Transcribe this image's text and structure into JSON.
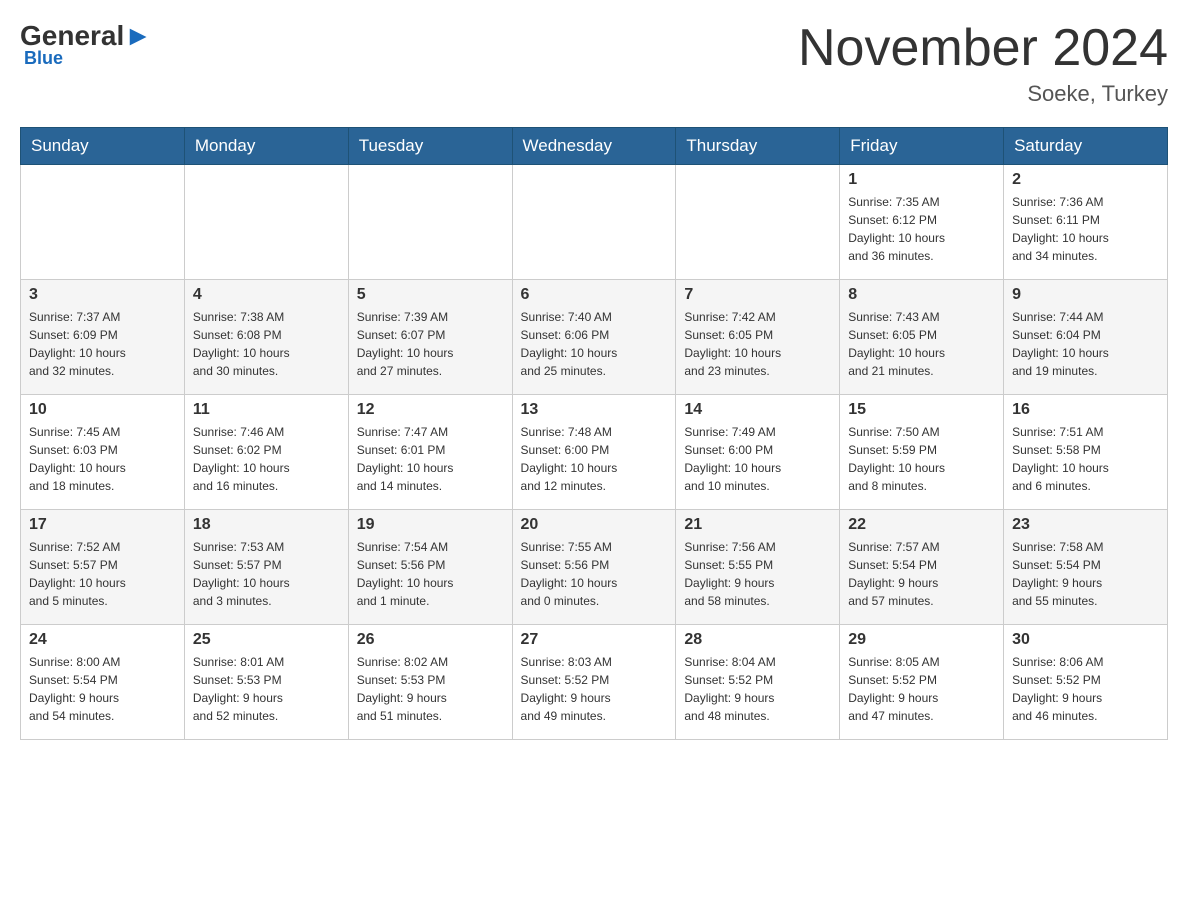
{
  "header": {
    "logo": {
      "general": "General",
      "blue": "Blue",
      "subtitle": "Blue"
    },
    "title": "November 2024",
    "location": "Soeke, Turkey"
  },
  "weekdays": [
    "Sunday",
    "Monday",
    "Tuesday",
    "Wednesday",
    "Thursday",
    "Friday",
    "Saturday"
  ],
  "weeks": [
    {
      "days": [
        {
          "number": "",
          "info": ""
        },
        {
          "number": "",
          "info": ""
        },
        {
          "number": "",
          "info": ""
        },
        {
          "number": "",
          "info": ""
        },
        {
          "number": "",
          "info": ""
        },
        {
          "number": "1",
          "info": "Sunrise: 7:35 AM\nSunset: 6:12 PM\nDaylight: 10 hours\nand 36 minutes."
        },
        {
          "number": "2",
          "info": "Sunrise: 7:36 AM\nSunset: 6:11 PM\nDaylight: 10 hours\nand 34 minutes."
        }
      ]
    },
    {
      "days": [
        {
          "number": "3",
          "info": "Sunrise: 7:37 AM\nSunset: 6:09 PM\nDaylight: 10 hours\nand 32 minutes."
        },
        {
          "number": "4",
          "info": "Sunrise: 7:38 AM\nSunset: 6:08 PM\nDaylight: 10 hours\nand 30 minutes."
        },
        {
          "number": "5",
          "info": "Sunrise: 7:39 AM\nSunset: 6:07 PM\nDaylight: 10 hours\nand 27 minutes."
        },
        {
          "number": "6",
          "info": "Sunrise: 7:40 AM\nSunset: 6:06 PM\nDaylight: 10 hours\nand 25 minutes."
        },
        {
          "number": "7",
          "info": "Sunrise: 7:42 AM\nSunset: 6:05 PM\nDaylight: 10 hours\nand 23 minutes."
        },
        {
          "number": "8",
          "info": "Sunrise: 7:43 AM\nSunset: 6:05 PM\nDaylight: 10 hours\nand 21 minutes."
        },
        {
          "number": "9",
          "info": "Sunrise: 7:44 AM\nSunset: 6:04 PM\nDaylight: 10 hours\nand 19 minutes."
        }
      ]
    },
    {
      "days": [
        {
          "number": "10",
          "info": "Sunrise: 7:45 AM\nSunset: 6:03 PM\nDaylight: 10 hours\nand 18 minutes."
        },
        {
          "number": "11",
          "info": "Sunrise: 7:46 AM\nSunset: 6:02 PM\nDaylight: 10 hours\nand 16 minutes."
        },
        {
          "number": "12",
          "info": "Sunrise: 7:47 AM\nSunset: 6:01 PM\nDaylight: 10 hours\nand 14 minutes."
        },
        {
          "number": "13",
          "info": "Sunrise: 7:48 AM\nSunset: 6:00 PM\nDaylight: 10 hours\nand 12 minutes."
        },
        {
          "number": "14",
          "info": "Sunrise: 7:49 AM\nSunset: 6:00 PM\nDaylight: 10 hours\nand 10 minutes."
        },
        {
          "number": "15",
          "info": "Sunrise: 7:50 AM\nSunset: 5:59 PM\nDaylight: 10 hours\nand 8 minutes."
        },
        {
          "number": "16",
          "info": "Sunrise: 7:51 AM\nSunset: 5:58 PM\nDaylight: 10 hours\nand 6 minutes."
        }
      ]
    },
    {
      "days": [
        {
          "number": "17",
          "info": "Sunrise: 7:52 AM\nSunset: 5:57 PM\nDaylight: 10 hours\nand 5 minutes."
        },
        {
          "number": "18",
          "info": "Sunrise: 7:53 AM\nSunset: 5:57 PM\nDaylight: 10 hours\nand 3 minutes."
        },
        {
          "number": "19",
          "info": "Sunrise: 7:54 AM\nSunset: 5:56 PM\nDaylight: 10 hours\nand 1 minute."
        },
        {
          "number": "20",
          "info": "Sunrise: 7:55 AM\nSunset: 5:56 PM\nDaylight: 10 hours\nand 0 minutes."
        },
        {
          "number": "21",
          "info": "Sunrise: 7:56 AM\nSunset: 5:55 PM\nDaylight: 9 hours\nand 58 minutes."
        },
        {
          "number": "22",
          "info": "Sunrise: 7:57 AM\nSunset: 5:54 PM\nDaylight: 9 hours\nand 57 minutes."
        },
        {
          "number": "23",
          "info": "Sunrise: 7:58 AM\nSunset: 5:54 PM\nDaylight: 9 hours\nand 55 minutes."
        }
      ]
    },
    {
      "days": [
        {
          "number": "24",
          "info": "Sunrise: 8:00 AM\nSunset: 5:54 PM\nDaylight: 9 hours\nand 54 minutes."
        },
        {
          "number": "25",
          "info": "Sunrise: 8:01 AM\nSunset: 5:53 PM\nDaylight: 9 hours\nand 52 minutes."
        },
        {
          "number": "26",
          "info": "Sunrise: 8:02 AM\nSunset: 5:53 PM\nDaylight: 9 hours\nand 51 minutes."
        },
        {
          "number": "27",
          "info": "Sunrise: 8:03 AM\nSunset: 5:52 PM\nDaylight: 9 hours\nand 49 minutes."
        },
        {
          "number": "28",
          "info": "Sunrise: 8:04 AM\nSunset: 5:52 PM\nDaylight: 9 hours\nand 48 minutes."
        },
        {
          "number": "29",
          "info": "Sunrise: 8:05 AM\nSunset: 5:52 PM\nDaylight: 9 hours\nand 47 minutes."
        },
        {
          "number": "30",
          "info": "Sunrise: 8:06 AM\nSunset: 5:52 PM\nDaylight: 9 hours\nand 46 minutes."
        }
      ]
    }
  ]
}
